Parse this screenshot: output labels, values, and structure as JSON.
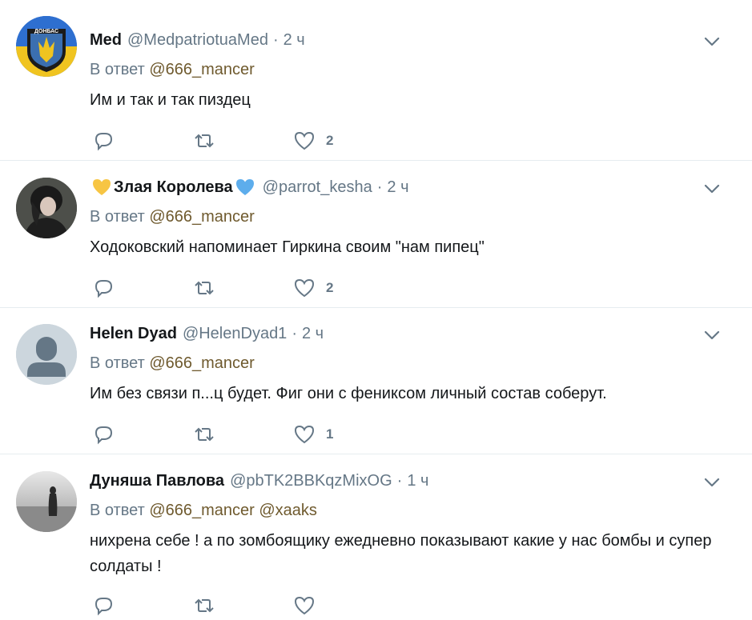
{
  "tweets": [
    {
      "name": "Med",
      "handle": "@MedpatriotuaMed",
      "dot": "·",
      "time": "2 ч",
      "reply_prefix": "В ответ",
      "mentions": "@666_mancer",
      "text": "Им и так и так пиздец",
      "like_count": "2",
      "avatar_text": "ДОНБАС",
      "avatar_colors": {
        "top": "#2e6fd0",
        "bottom": "#f0c420",
        "accent": "#1b1b1b"
      }
    },
    {
      "name": "Злая Королева",
      "name_prefix_emoji": "yellow-heart",
      "name_suffix_emoji": "blue-heart",
      "handle": "@parrot_kesha",
      "dot": "·",
      "time": "2 ч",
      "reply_prefix": "В ответ",
      "mentions": "@666_mancer",
      "text": "Ходоковский напоминает Гиркина своим \"нам пипец\"",
      "like_count": "2"
    },
    {
      "name": "Helen Dyad",
      "handle": "@HelenDyad1",
      "dot": "·",
      "time": "2 ч",
      "reply_prefix": "В ответ",
      "mentions": "@666_mancer",
      "text": "Им без связи п...ц будет. Фиг они с фениксом личный состав соберут.",
      "like_count": "1"
    },
    {
      "name": "Дуняша Павлова",
      "handle": "@pbTK2BBKqzMixOG",
      "dot": "·",
      "time": "1 ч",
      "reply_prefix": "В ответ",
      "mentions": "@666_mancer @xaaks",
      "text": "нихрена себе ! а по зомбоящику ежедневно показывают какие у нас бомбы и супер солдаты !",
      "like_count": ""
    }
  ],
  "colors": {
    "secondary_text": "#657786",
    "mention": "#6f5a2e",
    "divider": "#e6ecf0",
    "yellow_heart": "#f7c543",
    "blue_heart": "#5dadec"
  }
}
